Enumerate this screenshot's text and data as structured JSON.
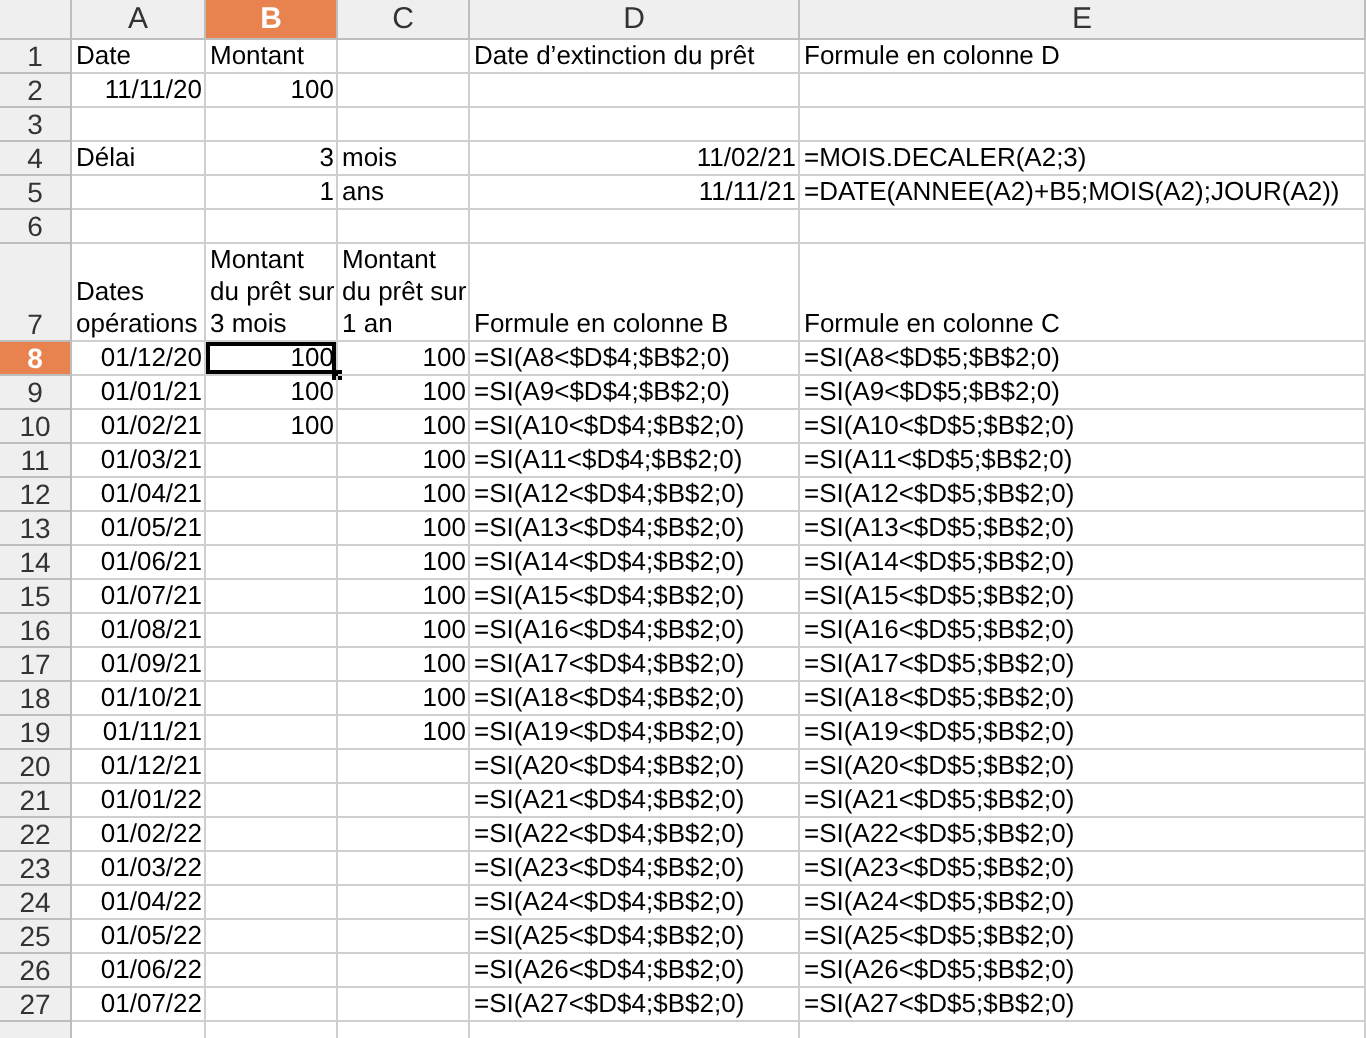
{
  "columns": [
    {
      "label": "A",
      "selected": false
    },
    {
      "label": "B",
      "selected": true
    },
    {
      "label": "C",
      "selected": false
    },
    {
      "label": "D",
      "selected": false
    },
    {
      "label": "E",
      "selected": false
    }
  ],
  "rows": [
    {
      "label": "1",
      "selected": false,
      "cells": [
        {
          "kind": "text",
          "text": "Date",
          "selected": false
        },
        {
          "kind": "text",
          "text": "Montant",
          "selected": false
        },
        {
          "kind": "empty",
          "selected": false
        },
        {
          "kind": "text",
          "text": "Date d’extinction du prêt",
          "selected": false
        },
        {
          "kind": "text",
          "text": "Formule en colonne D",
          "selected": false
        }
      ]
    },
    {
      "label": "2",
      "selected": false,
      "cells": [
        {
          "kind": "number",
          "text": "11/11/20",
          "selected": false
        },
        {
          "kind": "number",
          "text": "100",
          "selected": false
        },
        {
          "kind": "empty",
          "selected": false
        },
        {
          "kind": "empty",
          "selected": false
        },
        {
          "kind": "empty",
          "selected": false
        }
      ]
    },
    {
      "label": "3",
      "selected": false,
      "cells": [
        {
          "kind": "empty",
          "selected": false
        },
        {
          "kind": "empty",
          "selected": false
        },
        {
          "kind": "empty",
          "selected": false
        },
        {
          "kind": "empty",
          "selected": false
        },
        {
          "kind": "empty",
          "selected": false
        }
      ]
    },
    {
      "label": "4",
      "selected": false,
      "cells": [
        {
          "kind": "text",
          "text": "Délai",
          "selected": false
        },
        {
          "kind": "number",
          "text": "3",
          "selected": false
        },
        {
          "kind": "text",
          "text": "mois",
          "selected": false
        },
        {
          "kind": "number",
          "text": "11/02/21",
          "selected": false
        },
        {
          "kind": "text",
          "text": "=MOIS.DECALER(A2;3)",
          "selected": false
        }
      ]
    },
    {
      "label": "5",
      "selected": false,
      "cells": [
        {
          "kind": "empty",
          "selected": false
        },
        {
          "kind": "number",
          "text": "1",
          "selected": false
        },
        {
          "kind": "text",
          "text": "ans",
          "selected": false
        },
        {
          "kind": "number",
          "text": "11/11/21",
          "selected": false
        },
        {
          "kind": "text",
          "text": "=DATE(ANNEE(A2)+B5;MOIS(A2);JOUR(A2))",
          "selected": false
        }
      ]
    },
    {
      "label": "6",
      "selected": false,
      "cells": [
        {
          "kind": "empty",
          "selected": false
        },
        {
          "kind": "empty",
          "selected": false
        },
        {
          "kind": "empty",
          "selected": false
        },
        {
          "kind": "empty",
          "selected": false
        },
        {
          "kind": "empty",
          "selected": false
        }
      ]
    },
    {
      "label": "7",
      "selected": false,
      "cells": [
        {
          "kind": "wrap",
          "text": "Dates opérations",
          "selected": false
        },
        {
          "kind": "wrap",
          "text": "Montant du prêt sur 3 mois",
          "selected": false
        },
        {
          "kind": "wrap",
          "text": "Montant du prêt sur 1 an",
          "selected": false
        },
        {
          "kind": "text",
          "text": "Formule en colonne B",
          "selected": false
        },
        {
          "kind": "text",
          "text": "Formule en colonne C",
          "selected": false
        }
      ]
    },
    {
      "label": "8",
      "selected": true,
      "cells": [
        {
          "kind": "number",
          "text": "01/12/20",
          "selected": false
        },
        {
          "kind": "number",
          "text": "100",
          "selected": true
        },
        {
          "kind": "number",
          "text": "100",
          "selected": false
        },
        {
          "kind": "text",
          "text": "=SI(A8<$D$4;$B$2;0)",
          "selected": false
        },
        {
          "kind": "text",
          "text": "=SI(A8<$D$5;$B$2;0)",
          "selected": false
        }
      ]
    },
    {
      "label": "9",
      "selected": false,
      "cells": [
        {
          "kind": "number",
          "text": "01/01/21",
          "selected": false
        },
        {
          "kind": "number",
          "text": "100",
          "selected": false
        },
        {
          "kind": "number",
          "text": "100",
          "selected": false
        },
        {
          "kind": "text",
          "text": "=SI(A9<$D$4;$B$2;0)",
          "selected": false
        },
        {
          "kind": "text",
          "text": "=SI(A9<$D$5;$B$2;0)",
          "selected": false
        }
      ]
    },
    {
      "label": "10",
      "selected": false,
      "cells": [
        {
          "kind": "number",
          "text": "01/02/21",
          "selected": false
        },
        {
          "kind": "number",
          "text": "100",
          "selected": false
        },
        {
          "kind": "number",
          "text": "100",
          "selected": false
        },
        {
          "kind": "text",
          "text": "=SI(A10<$D$4;$B$2;0)",
          "selected": false
        },
        {
          "kind": "text",
          "text": "=SI(A10<$D$5;$B$2;0)",
          "selected": false
        }
      ]
    },
    {
      "label": "11",
      "selected": false,
      "cells": [
        {
          "kind": "number",
          "text": "01/03/21",
          "selected": false
        },
        {
          "kind": "empty",
          "selected": false
        },
        {
          "kind": "number",
          "text": "100",
          "selected": false
        },
        {
          "kind": "text",
          "text": "=SI(A11<$D$4;$B$2;0)",
          "selected": false
        },
        {
          "kind": "text",
          "text": "=SI(A11<$D$5;$B$2;0)",
          "selected": false
        }
      ]
    },
    {
      "label": "12",
      "selected": false,
      "cells": [
        {
          "kind": "number",
          "text": "01/04/21",
          "selected": false
        },
        {
          "kind": "empty",
          "selected": false
        },
        {
          "kind": "number",
          "text": "100",
          "selected": false
        },
        {
          "kind": "text",
          "text": "=SI(A12<$D$4;$B$2;0)",
          "selected": false
        },
        {
          "kind": "text",
          "text": "=SI(A12<$D$5;$B$2;0)",
          "selected": false
        }
      ]
    },
    {
      "label": "13",
      "selected": false,
      "cells": [
        {
          "kind": "number",
          "text": "01/05/21",
          "selected": false
        },
        {
          "kind": "empty",
          "selected": false
        },
        {
          "kind": "number",
          "text": "100",
          "selected": false
        },
        {
          "kind": "text",
          "text": "=SI(A13<$D$4;$B$2;0)",
          "selected": false
        },
        {
          "kind": "text",
          "text": "=SI(A13<$D$5;$B$2;0)",
          "selected": false
        }
      ]
    },
    {
      "label": "14",
      "selected": false,
      "cells": [
        {
          "kind": "number",
          "text": "01/06/21",
          "selected": false
        },
        {
          "kind": "empty",
          "selected": false
        },
        {
          "kind": "number",
          "text": "100",
          "selected": false
        },
        {
          "kind": "text",
          "text": "=SI(A14<$D$4;$B$2;0)",
          "selected": false
        },
        {
          "kind": "text",
          "text": "=SI(A14<$D$5;$B$2;0)",
          "selected": false
        }
      ]
    },
    {
      "label": "15",
      "selected": false,
      "cells": [
        {
          "kind": "number",
          "text": "01/07/21",
          "selected": false
        },
        {
          "kind": "empty",
          "selected": false
        },
        {
          "kind": "number",
          "text": "100",
          "selected": false
        },
        {
          "kind": "text",
          "text": "=SI(A15<$D$4;$B$2;0)",
          "selected": false
        },
        {
          "kind": "text",
          "text": "=SI(A15<$D$5;$B$2;0)",
          "selected": false
        }
      ]
    },
    {
      "label": "16",
      "selected": false,
      "cells": [
        {
          "kind": "number",
          "text": "01/08/21",
          "selected": false
        },
        {
          "kind": "empty",
          "selected": false
        },
        {
          "kind": "number",
          "text": "100",
          "selected": false
        },
        {
          "kind": "text",
          "text": "=SI(A16<$D$4;$B$2;0)",
          "selected": false
        },
        {
          "kind": "text",
          "text": "=SI(A16<$D$5;$B$2;0)",
          "selected": false
        }
      ]
    },
    {
      "label": "17",
      "selected": false,
      "cells": [
        {
          "kind": "number",
          "text": "01/09/21",
          "selected": false
        },
        {
          "kind": "empty",
          "selected": false
        },
        {
          "kind": "number",
          "text": "100",
          "selected": false
        },
        {
          "kind": "text",
          "text": "=SI(A17<$D$4;$B$2;0)",
          "selected": false
        },
        {
          "kind": "text",
          "text": "=SI(A17<$D$5;$B$2;0)",
          "selected": false
        }
      ]
    },
    {
      "label": "18",
      "selected": false,
      "cells": [
        {
          "kind": "number",
          "text": "01/10/21",
          "selected": false
        },
        {
          "kind": "empty",
          "selected": false
        },
        {
          "kind": "number",
          "text": "100",
          "selected": false
        },
        {
          "kind": "text",
          "text": "=SI(A18<$D$4;$B$2;0)",
          "selected": false
        },
        {
          "kind": "text",
          "text": "=SI(A18<$D$5;$B$2;0)",
          "selected": false
        }
      ]
    },
    {
      "label": "19",
      "selected": false,
      "cells": [
        {
          "kind": "number",
          "text": "01/11/21",
          "selected": false
        },
        {
          "kind": "empty",
          "selected": false
        },
        {
          "kind": "number",
          "text": "100",
          "selected": false
        },
        {
          "kind": "text",
          "text": "=SI(A19<$D$4;$B$2;0)",
          "selected": false
        },
        {
          "kind": "text",
          "text": "=SI(A19<$D$5;$B$2;0)",
          "selected": false
        }
      ]
    },
    {
      "label": "20",
      "selected": false,
      "cells": [
        {
          "kind": "number",
          "text": "01/12/21",
          "selected": false
        },
        {
          "kind": "empty",
          "selected": false
        },
        {
          "kind": "empty",
          "selected": false
        },
        {
          "kind": "text",
          "text": "=SI(A20<$D$4;$B$2;0)",
          "selected": false
        },
        {
          "kind": "text",
          "text": "=SI(A20<$D$5;$B$2;0)",
          "selected": false
        }
      ]
    },
    {
      "label": "21",
      "selected": false,
      "cells": [
        {
          "kind": "number",
          "text": "01/01/22",
          "selected": false
        },
        {
          "kind": "empty",
          "selected": false
        },
        {
          "kind": "empty",
          "selected": false
        },
        {
          "kind": "text",
          "text": "=SI(A21<$D$4;$B$2;0)",
          "selected": false
        },
        {
          "kind": "text",
          "text": "=SI(A21<$D$5;$B$2;0)",
          "selected": false
        }
      ]
    },
    {
      "label": "22",
      "selected": false,
      "cells": [
        {
          "kind": "number",
          "text": "01/02/22",
          "selected": false
        },
        {
          "kind": "empty",
          "selected": false
        },
        {
          "kind": "empty",
          "selected": false
        },
        {
          "kind": "text",
          "text": "=SI(A22<$D$4;$B$2;0)",
          "selected": false
        },
        {
          "kind": "text",
          "text": "=SI(A22<$D$5;$B$2;0)",
          "selected": false
        }
      ]
    },
    {
      "label": "23",
      "selected": false,
      "cells": [
        {
          "kind": "number",
          "text": "01/03/22",
          "selected": false
        },
        {
          "kind": "empty",
          "selected": false
        },
        {
          "kind": "empty",
          "selected": false
        },
        {
          "kind": "text",
          "text": "=SI(A23<$D$4;$B$2;0)",
          "selected": false
        },
        {
          "kind": "text",
          "text": "=SI(A23<$D$5;$B$2;0)",
          "selected": false
        }
      ]
    },
    {
      "label": "24",
      "selected": false,
      "cells": [
        {
          "kind": "number",
          "text": "01/04/22",
          "selected": false
        },
        {
          "kind": "empty",
          "selected": false
        },
        {
          "kind": "empty",
          "selected": false
        },
        {
          "kind": "text",
          "text": "=SI(A24<$D$4;$B$2;0)",
          "selected": false
        },
        {
          "kind": "text",
          "text": "=SI(A24<$D$5;$B$2;0)",
          "selected": false
        }
      ]
    },
    {
      "label": "25",
      "selected": false,
      "cells": [
        {
          "kind": "number",
          "text": "01/05/22",
          "selected": false
        },
        {
          "kind": "empty",
          "selected": false
        },
        {
          "kind": "empty",
          "selected": false
        },
        {
          "kind": "text",
          "text": "=SI(A25<$D$4;$B$2;0)",
          "selected": false
        },
        {
          "kind": "text",
          "text": "=SI(A25<$D$5;$B$2;0)",
          "selected": false
        }
      ]
    },
    {
      "label": "26",
      "selected": false,
      "cells": [
        {
          "kind": "number",
          "text": "01/06/22",
          "selected": false
        },
        {
          "kind": "empty",
          "selected": false
        },
        {
          "kind": "empty",
          "selected": false
        },
        {
          "kind": "text",
          "text": "=SI(A26<$D$4;$B$2;0)",
          "selected": false
        },
        {
          "kind": "text",
          "text": "=SI(A26<$D$5;$B$2;0)",
          "selected": false
        }
      ]
    },
    {
      "label": "27",
      "selected": false,
      "cells": [
        {
          "kind": "number",
          "text": "01/07/22",
          "selected": false
        },
        {
          "kind": "empty",
          "selected": false
        },
        {
          "kind": "empty",
          "selected": false
        },
        {
          "kind": "text",
          "text": "=SI(A27<$D$4;$B$2;0)",
          "selected": false
        },
        {
          "kind": "text",
          "text": "=SI(A27<$D$5;$B$2;0)",
          "selected": false
        }
      ]
    }
  ]
}
